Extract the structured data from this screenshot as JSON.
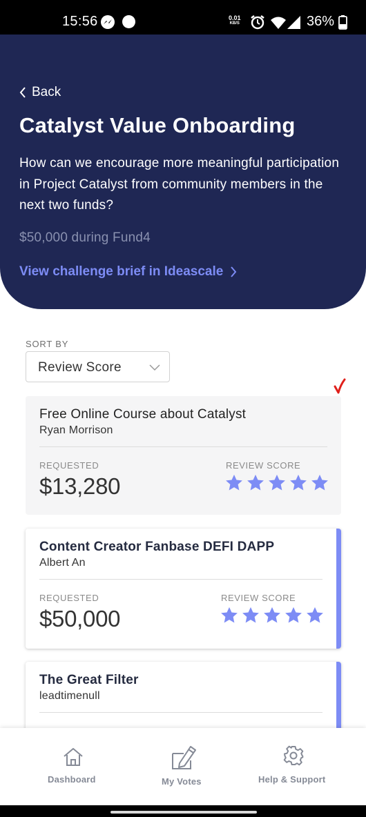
{
  "status_bar": {
    "time": "15:56",
    "data_rate": "0.01",
    "data_rate_unit": "KB/S",
    "battery_percent": "36%",
    "icons": [
      "messenger-icon",
      "circle-notification-icon",
      "alarm-icon",
      "wifi-icon",
      "signal-icon",
      "battery-icon"
    ]
  },
  "header": {
    "back_label": "Back",
    "title": "Catalyst Value Onboarding",
    "question": "How can we encourage more meaningful participation in Project Catalyst from community members in the next two funds?",
    "fund_info": "$50,000 during Fund4",
    "brief_link": "View challenge brief in Ideascale"
  },
  "sort": {
    "label": "SORT BY",
    "selected": "Review Score"
  },
  "proposals": [
    {
      "title": "Free Online Course about Catalyst",
      "author": "Ryan Morrison",
      "requested_label": "REQUESTED",
      "requested": "$13,280",
      "score_label": "REVIEW SCORE",
      "stars": 5,
      "voted": true
    },
    {
      "title": "Content Creator Fanbase DEFI DAPP",
      "author": "Albert An",
      "requested_label": "REQUESTED",
      "requested": "$50,000",
      "score_label": "REVIEW SCORE",
      "stars": 5,
      "voted": false
    },
    {
      "title": "The Great Filter",
      "author": "leadtimenull",
      "voted": false
    }
  ],
  "bottom_nav": {
    "dashboard": "Dashboard",
    "my_votes": "My Votes",
    "help": "Help & Support"
  },
  "colors": {
    "header_bg": "#1f2754",
    "accent": "#7d8cf5",
    "check": "#e0201b",
    "inactive_card_bg": "#f5f5f6"
  }
}
